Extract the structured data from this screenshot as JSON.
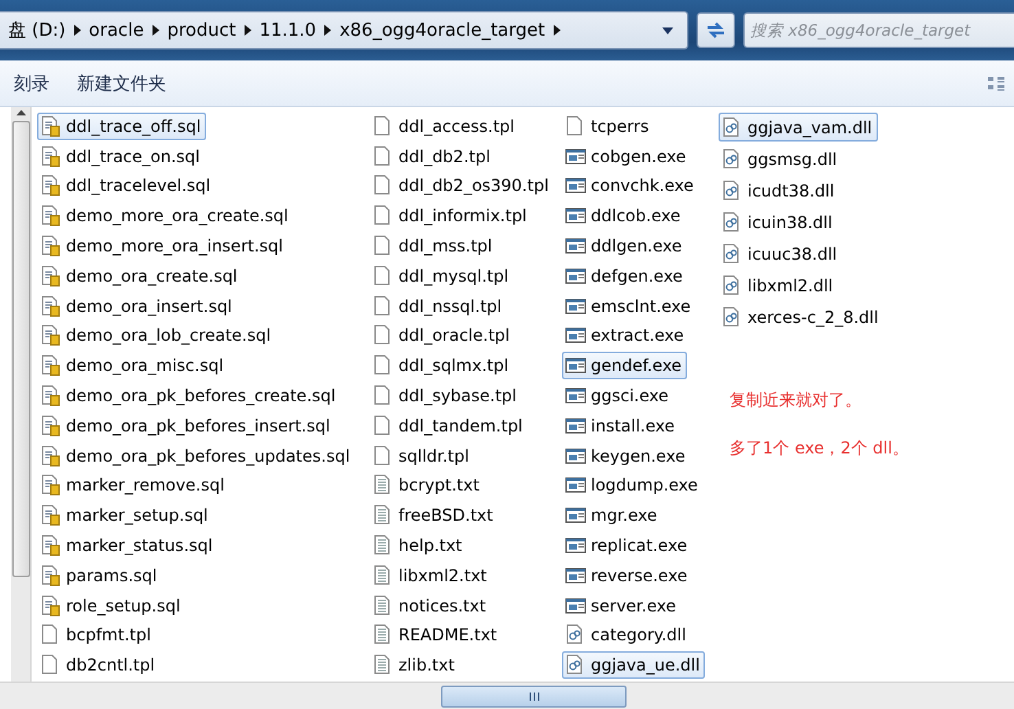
{
  "address_bar": {
    "crumbs": [
      "盘 (D:)",
      "oracle",
      "product",
      "11.1.0",
      "x86_ogg4oracle_target"
    ]
  },
  "search": {
    "placeholder": "搜索 x86_ogg4oracle_target"
  },
  "toolbar": {
    "buttons": [
      "刻录",
      "新建文件夹"
    ]
  },
  "columns": [
    [
      {
        "name": "ddl_trace_off.sql",
        "kind": "script",
        "selected": true
      },
      {
        "name": "ddl_trace_on.sql",
        "kind": "script",
        "selected": false
      },
      {
        "name": "ddl_tracelevel.sql",
        "kind": "script",
        "selected": false
      },
      {
        "name": "demo_more_ora_create.sql",
        "kind": "script",
        "selected": false
      },
      {
        "name": "demo_more_ora_insert.sql",
        "kind": "script",
        "selected": false
      },
      {
        "name": "demo_ora_create.sql",
        "kind": "script",
        "selected": false
      },
      {
        "name": "demo_ora_insert.sql",
        "kind": "script",
        "selected": false
      },
      {
        "name": "demo_ora_lob_create.sql",
        "kind": "script",
        "selected": false
      },
      {
        "name": "demo_ora_misc.sql",
        "kind": "script",
        "selected": false
      },
      {
        "name": "demo_ora_pk_befores_create.sql",
        "kind": "script",
        "selected": false
      },
      {
        "name": "demo_ora_pk_befores_insert.sql",
        "kind": "script",
        "selected": false
      },
      {
        "name": "demo_ora_pk_befores_updates.sql",
        "kind": "script",
        "selected": false
      },
      {
        "name": "marker_remove.sql",
        "kind": "script",
        "selected": false
      },
      {
        "name": "marker_setup.sql",
        "kind": "script",
        "selected": false
      },
      {
        "name": "marker_status.sql",
        "kind": "script",
        "selected": false
      },
      {
        "name": "params.sql",
        "kind": "script",
        "selected": false
      },
      {
        "name": "role_setup.sql",
        "kind": "script",
        "selected": false
      },
      {
        "name": "bcpfmt.tpl",
        "kind": "blank",
        "selected": false
      },
      {
        "name": "db2cntl.tpl",
        "kind": "blank",
        "selected": false
      }
    ],
    [
      {
        "name": "ddl_access.tpl",
        "kind": "blank",
        "selected": false
      },
      {
        "name": "ddl_db2.tpl",
        "kind": "blank",
        "selected": false
      },
      {
        "name": "ddl_db2_os390.tpl",
        "kind": "blank",
        "selected": false
      },
      {
        "name": "ddl_informix.tpl",
        "kind": "blank",
        "selected": false
      },
      {
        "name": "ddl_mss.tpl",
        "kind": "blank",
        "selected": false
      },
      {
        "name": "ddl_mysql.tpl",
        "kind": "blank",
        "selected": false
      },
      {
        "name": "ddl_nssql.tpl",
        "kind": "blank",
        "selected": false
      },
      {
        "name": "ddl_oracle.tpl",
        "kind": "blank",
        "selected": false
      },
      {
        "name": "ddl_sqlmx.tpl",
        "kind": "blank",
        "selected": false
      },
      {
        "name": "ddl_sybase.tpl",
        "kind": "blank",
        "selected": false
      },
      {
        "name": "ddl_tandem.tpl",
        "kind": "blank",
        "selected": false
      },
      {
        "name": "sqlldr.tpl",
        "kind": "blank",
        "selected": false
      },
      {
        "name": "bcrypt.txt",
        "kind": "text",
        "selected": false
      },
      {
        "name": "freeBSD.txt",
        "kind": "text",
        "selected": false
      },
      {
        "name": "help.txt",
        "kind": "text",
        "selected": false
      },
      {
        "name": "libxml2.txt",
        "kind": "text",
        "selected": false
      },
      {
        "name": "notices.txt",
        "kind": "text",
        "selected": false
      },
      {
        "name": "README.txt",
        "kind": "text",
        "selected": false
      },
      {
        "name": "zlib.txt",
        "kind": "text",
        "selected": false
      }
    ],
    [
      {
        "name": "tcperrs",
        "kind": "blank",
        "selected": false
      },
      {
        "name": "cobgen.exe",
        "kind": "program",
        "selected": false
      },
      {
        "name": "convchk.exe",
        "kind": "program",
        "selected": false
      },
      {
        "name": "ddlcob.exe",
        "kind": "program",
        "selected": false
      },
      {
        "name": "ddlgen.exe",
        "kind": "program",
        "selected": false
      },
      {
        "name": "defgen.exe",
        "kind": "program",
        "selected": false
      },
      {
        "name": "emsclnt.exe",
        "kind": "program",
        "selected": false
      },
      {
        "name": "extract.exe",
        "kind": "program",
        "selected": false
      },
      {
        "name": "gendef.exe",
        "kind": "program",
        "selected": true
      },
      {
        "name": "ggsci.exe",
        "kind": "program",
        "selected": false
      },
      {
        "name": "install.exe",
        "kind": "program",
        "selected": false
      },
      {
        "name": "keygen.exe",
        "kind": "program",
        "selected": false
      },
      {
        "name": "logdump.exe",
        "kind": "program",
        "selected": false
      },
      {
        "name": "mgr.exe",
        "kind": "program",
        "selected": false
      },
      {
        "name": "replicat.exe",
        "kind": "program",
        "selected": false
      },
      {
        "name": "reverse.exe",
        "kind": "program",
        "selected": false
      },
      {
        "name": "server.exe",
        "kind": "program",
        "selected": false
      },
      {
        "name": "category.dll",
        "kind": "library",
        "selected": false
      },
      {
        "name": "ggjava_ue.dll",
        "kind": "library",
        "selected": true
      }
    ],
    [
      {
        "name": "ggjava_vam.dll",
        "kind": "library",
        "selected": true
      },
      {
        "name": "ggsmsg.dll",
        "kind": "library",
        "selected": false
      },
      {
        "name": "icudt38.dll",
        "kind": "library",
        "selected": false
      },
      {
        "name": "icuin38.dll",
        "kind": "library",
        "selected": false
      },
      {
        "name": "icuuc38.dll",
        "kind": "library",
        "selected": false
      },
      {
        "name": "libxml2.dll",
        "kind": "library",
        "selected": false
      },
      {
        "name": "xerces-c_2_8.dll",
        "kind": "library",
        "selected": false
      }
    ]
  ],
  "notes": [
    "复制近来就对了。",
    "多了1个 exe，2个 dll。"
  ]
}
